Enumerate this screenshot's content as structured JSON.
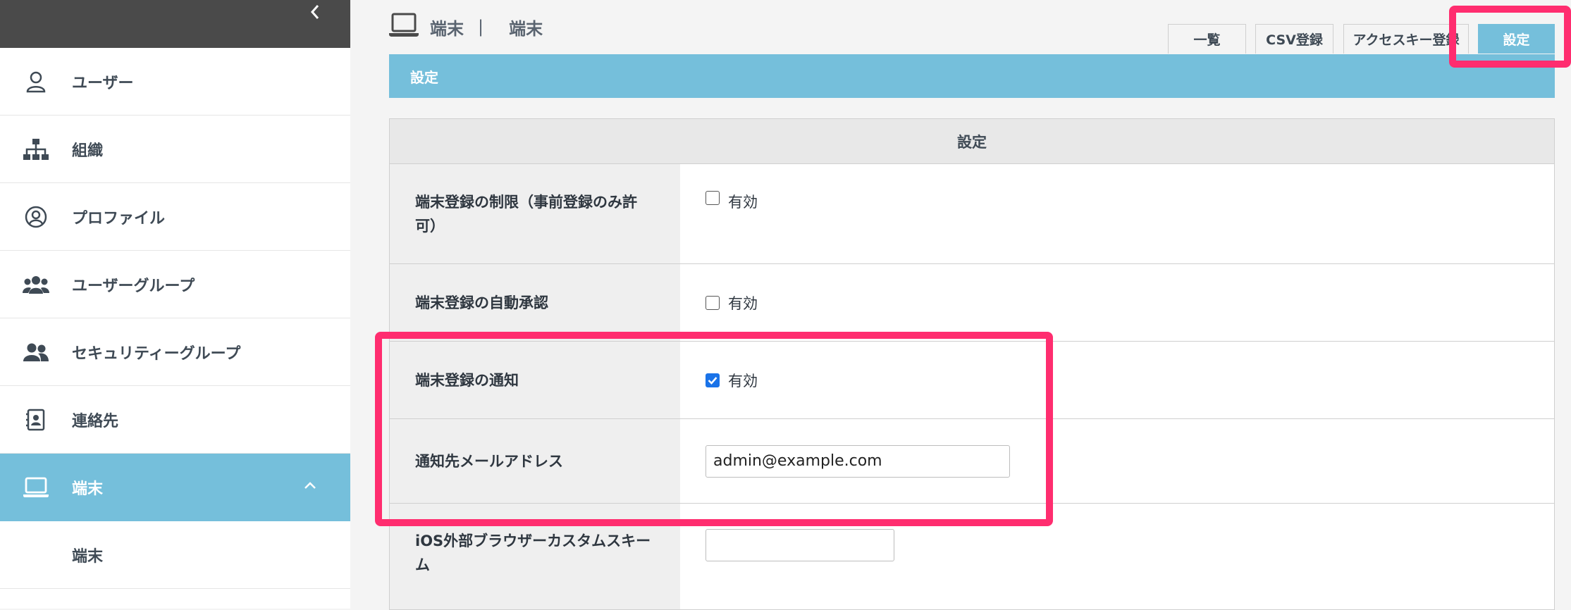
{
  "sidebar": {
    "collapse_icon": "chevron-left-icon",
    "items": [
      {
        "label": "ユーザー",
        "icon": "user-icon"
      },
      {
        "label": "組織",
        "icon": "org-chart-icon"
      },
      {
        "label": "プロファイル",
        "icon": "profile-icon"
      },
      {
        "label": "ユーザーグループ",
        "icon": "user-group-icon"
      },
      {
        "label": "セキュリティーグループ",
        "icon": "security-group-icon"
      },
      {
        "label": "連絡先",
        "icon": "contacts-icon"
      },
      {
        "label": "端末",
        "icon": "laptop-icon",
        "active": true
      }
    ],
    "sub_items": [
      {
        "label": "端末"
      }
    ]
  },
  "header": {
    "icon": "laptop-icon",
    "crumb1": "端末",
    "separator": "|",
    "crumb2": "端末"
  },
  "tabs": [
    {
      "label": "一覧"
    },
    {
      "label": "CSV登録"
    },
    {
      "label": "アクセスキー登録"
    },
    {
      "label": "設定",
      "active": true
    }
  ],
  "section_title": "設定",
  "form": {
    "heading": "設定",
    "rows": [
      {
        "label": "端末登録の制限（事前登録のみ許可）",
        "checkbox_label": "有効",
        "checked": false
      },
      {
        "label": "端末登録の自動承認",
        "checkbox_label": "有効",
        "checked": false
      },
      {
        "label": "端末登録の通知",
        "checkbox_label": "有効",
        "checked": true
      },
      {
        "label": "通知先メールアドレス",
        "input_value": "admin@example.com"
      },
      {
        "label": "iOS外部ブラウザーカスタムスキーム",
        "input_value": ""
      }
    ]
  },
  "colors": {
    "accent": "#75bfdb",
    "highlight": "#ff2d6f",
    "sidebar_top": "#4a4a4a"
  }
}
